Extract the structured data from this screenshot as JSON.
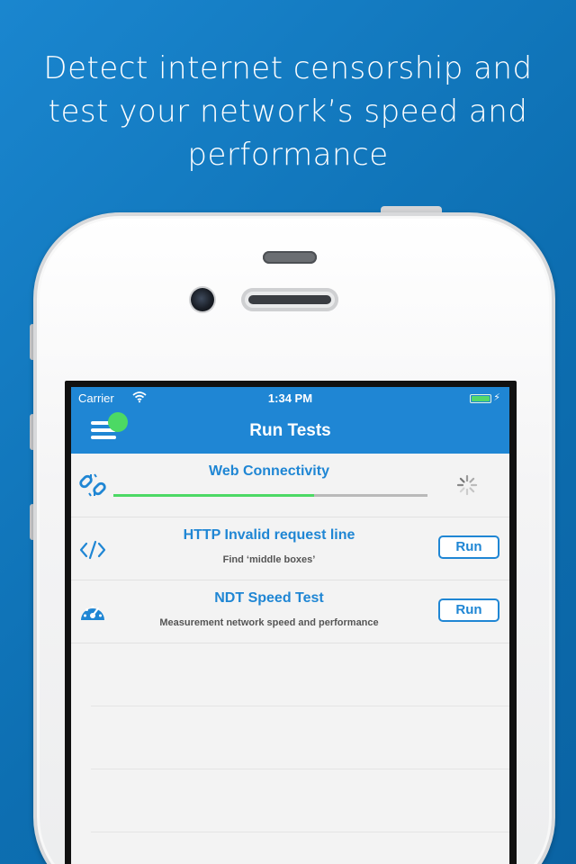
{
  "headline": "Detect internet censorship and test your network’s speed and performance",
  "status_bar": {
    "carrier": "Carrier",
    "time": "1:34 PM"
  },
  "app_bar": {
    "title": "Run Tests"
  },
  "tests": [
    {
      "title": "Web Connectivity",
      "icon": "broken-link-icon",
      "state": "running",
      "progress": 0.64
    },
    {
      "title": "HTTP Invalid request line",
      "subtitle": "Find ‘middle boxes’",
      "icon": "code-icon",
      "button_label": "Run"
    },
    {
      "title": "NDT Speed Test",
      "subtitle": "Measurement network speed and performance",
      "icon": "speedometer-icon",
      "button_label": "Run"
    }
  ],
  "colors": {
    "background": "#1478c2",
    "app_bar": "#1f86d4",
    "accent_green": "#4cd964",
    "list_background": "#f3f3f3"
  }
}
